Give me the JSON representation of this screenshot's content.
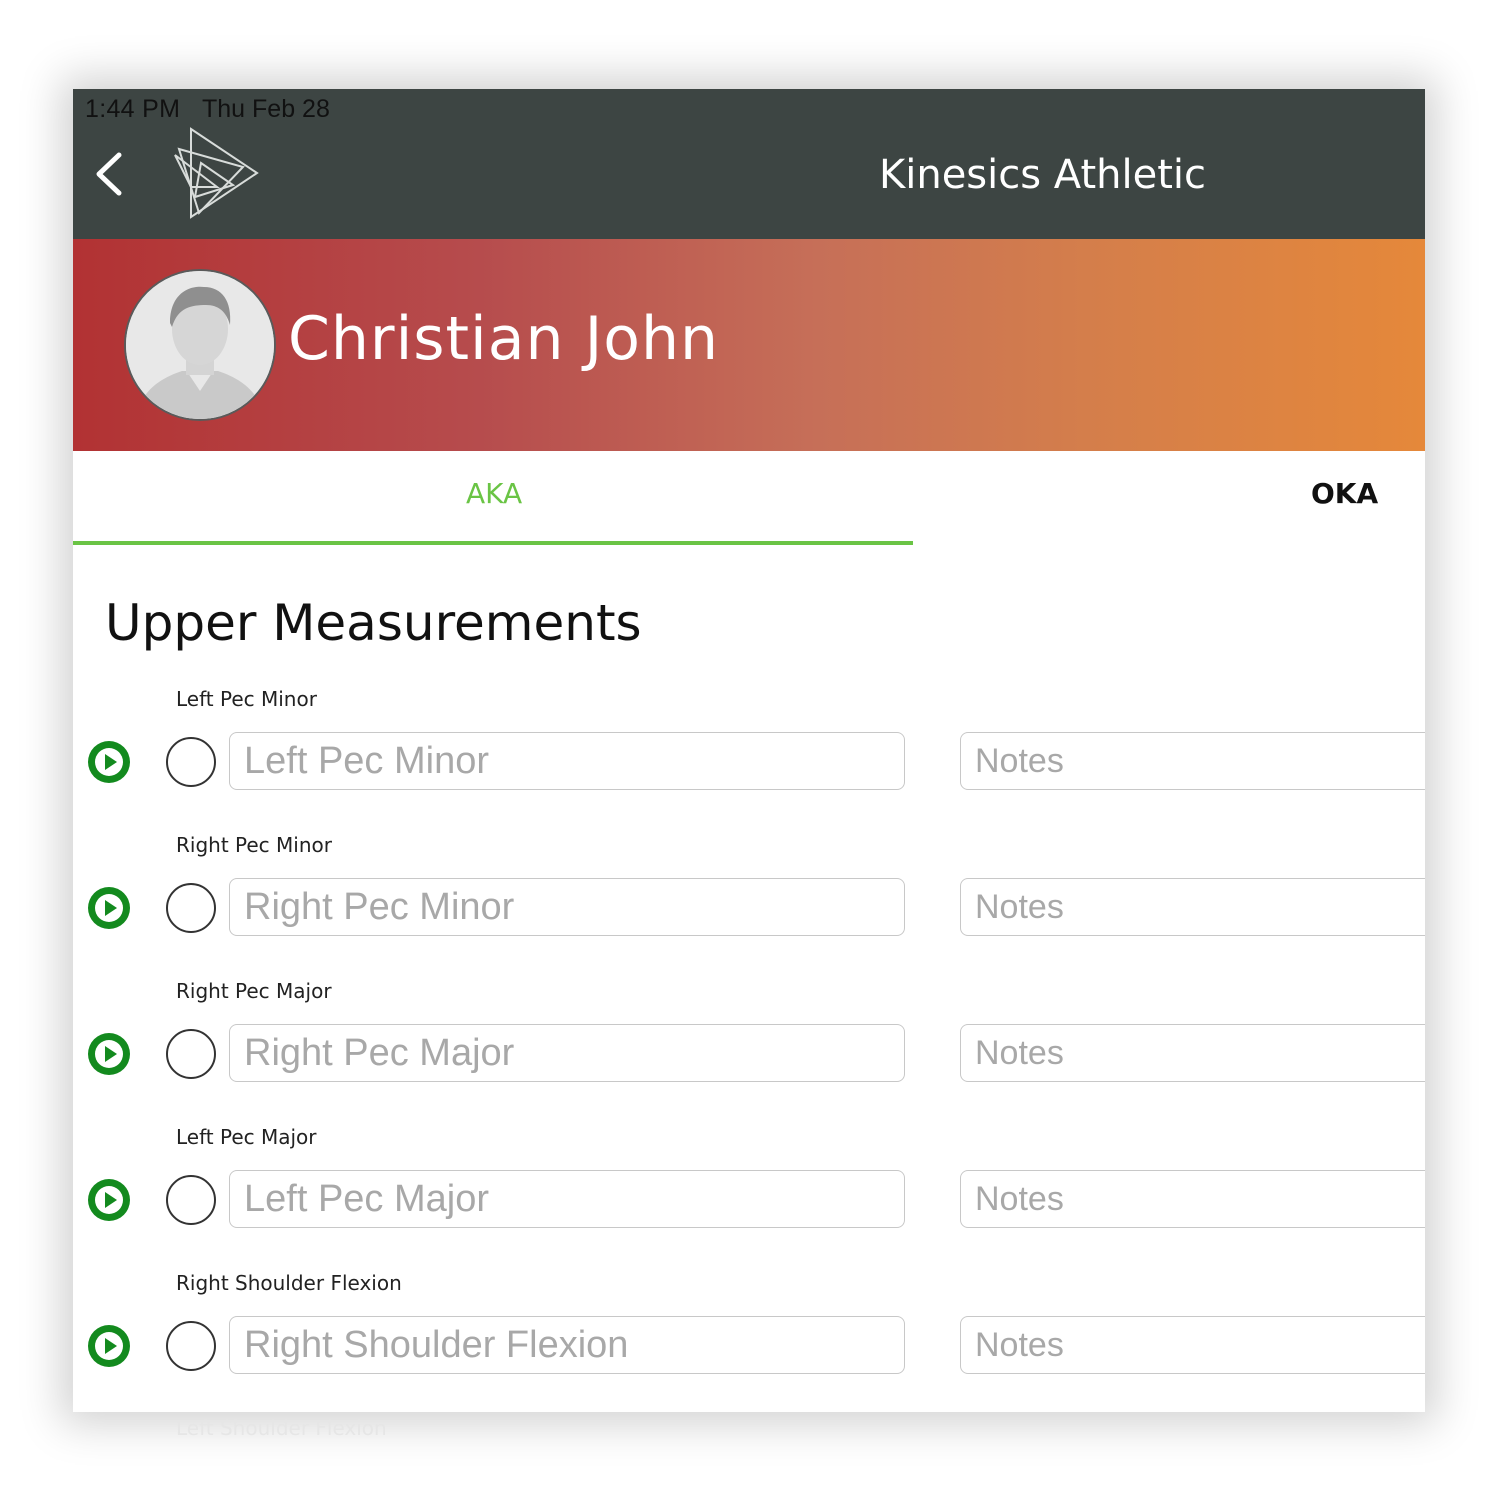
{
  "status_bar": {
    "time": "1:44 PM",
    "date": "Thu Feb 28"
  },
  "header": {
    "title": "Kinesics Athletic",
    "back_icon": "chevron-left-icon",
    "logo_icon": "triangles-logo-icon"
  },
  "profile": {
    "name": "Christian John",
    "avatar_icon": "person-avatar-icon"
  },
  "tabs": [
    {
      "label": "AKA",
      "active": true
    },
    {
      "label": "OKA",
      "active": false
    }
  ],
  "section": {
    "title": "Upper Measurements"
  },
  "rows": [
    {
      "label": "Left Pec Minor",
      "placeholder": "Left Pec Minor",
      "notes_placeholder": "Notes"
    },
    {
      "label": "Right Pec Minor",
      "placeholder": "Right Pec Minor",
      "notes_placeholder": "Notes"
    },
    {
      "label": "Right Pec Major",
      "placeholder": "Right Pec Major",
      "notes_placeholder": "Notes"
    },
    {
      "label": "Left Pec Major",
      "placeholder": "Left Pec Major",
      "notes_placeholder": "Notes"
    },
    {
      "label": "Right Shoulder Flexion",
      "placeholder": "Right Shoulder Flexion",
      "notes_placeholder": "Notes"
    }
  ],
  "next_row_label": "Left Shoulder Flexion",
  "colors": {
    "header_bg": "#3d4543",
    "accent_green": "#6ac445",
    "play_green": "#138a1e",
    "gradient_start": "#b23233",
    "gradient_end": "#e5883a"
  }
}
